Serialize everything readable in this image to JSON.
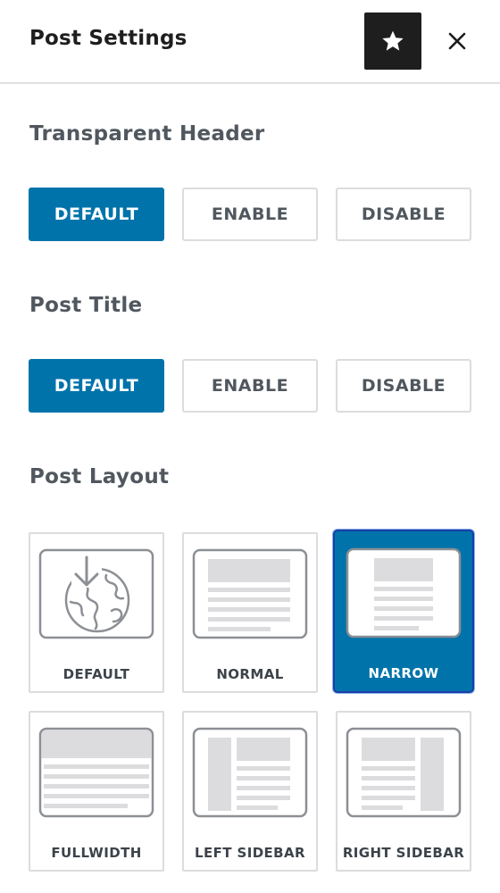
{
  "header": {
    "title": "Post Settings",
    "star_icon": "star-icon",
    "close_icon": "close-icon"
  },
  "transparent_header": {
    "title": "Transparent Header",
    "options": [
      "DEFAULT",
      "ENABLE",
      "DISABLE"
    ],
    "selected": "DEFAULT"
  },
  "post_title": {
    "title": "Post Title",
    "options": [
      "DEFAULT",
      "ENABLE",
      "DISABLE"
    ],
    "selected": "DEFAULT"
  },
  "post_layout": {
    "title": "Post Layout",
    "options": [
      {
        "label": "DEFAULT",
        "icon": "globe-download-icon"
      },
      {
        "label": "NORMAL",
        "icon": "layout-normal-icon"
      },
      {
        "label": "NARROW",
        "icon": "layout-narrow-icon"
      },
      {
        "label": "FULLWIDTH",
        "icon": "layout-fullwidth-icon"
      },
      {
        "label": "LEFT SIDEBAR",
        "icon": "layout-left-sidebar-icon"
      },
      {
        "label": "RIGHT SIDEBAR",
        "icon": "layout-right-sidebar-icon"
      }
    ],
    "selected": "NARROW"
  },
  "colors": {
    "accent": "#0073aa",
    "dark": "#1e1e1e",
    "text_muted": "#50575e",
    "border": "#dcdcde"
  }
}
